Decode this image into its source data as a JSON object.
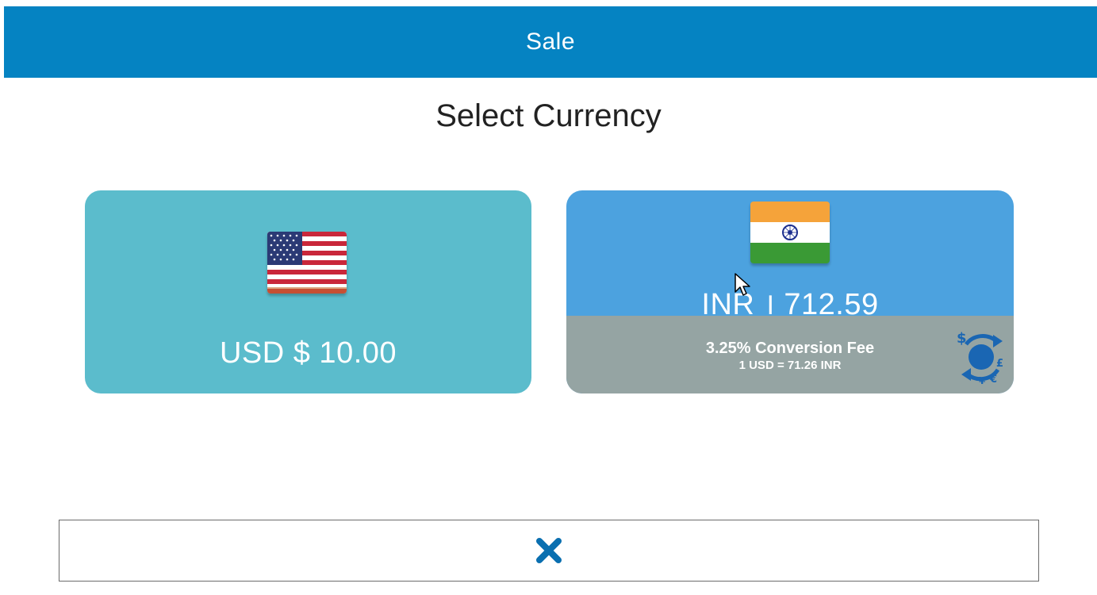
{
  "header": {
    "title": "Sale"
  },
  "page": {
    "subtitle": "Select Currency"
  },
  "options": [
    {
      "currency": "USD",
      "label": "USD $ 10.00",
      "flag_icon": "us-flag-icon"
    },
    {
      "currency": "INR",
      "label": "INR । 712.59",
      "flag_icon": "india-flag-icon",
      "fee_text": "3.25% Conversion Fee",
      "rate_text": "1 USD = 71.26 INR",
      "conversion_icon": "currency-exchange-icon"
    }
  ],
  "cancel": {
    "icon": "close-icon"
  },
  "colors": {
    "header": "#0583c2",
    "usd_card": "#5bbccc",
    "inr_card": "#4ca2df",
    "fee_band": "#95a4a3",
    "cancel_icon": "#0a6fb0"
  }
}
